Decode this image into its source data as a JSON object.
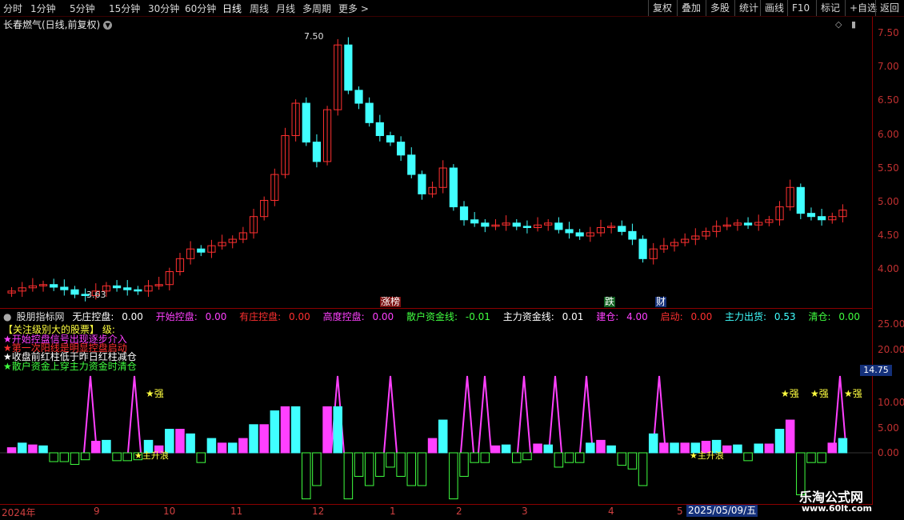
{
  "toolbar": {
    "timeframes": [
      "分时",
      "1分钟",
      "5分钟",
      "15分钟",
      "30分钟",
      "60分钟",
      "日线",
      "周线",
      "月线",
      "多周期",
      "更多 >"
    ],
    "active": "日线",
    "right_buttons": [
      "复权",
      "叠加",
      "多股",
      "统计",
      "画线",
      "F10",
      "标记",
      "+自选",
      "返回"
    ]
  },
  "chart_title": "长春燃气(日线,前复权)",
  "chart_data": [
    {
      "type": "candlestick",
      "title": "长春燃气(日线,前复权)",
      "y_ticks": [
        "7.50",
        "7.00",
        "6.50",
        "6.00",
        "5.50",
        "5.00",
        "4.50",
        "4.00"
      ],
      "ylim": [
        3.5,
        7.7
      ],
      "annotations": {
        "high": "7.50",
        "low": "3.63"
      },
      "event_tags": [
        "涨榜",
        "跌",
        "财"
      ],
      "ohlc_closes": [
        3.7,
        3.75,
        3.78,
        3.8,
        3.76,
        3.72,
        3.65,
        3.63,
        3.7,
        3.78,
        3.75,
        3.72,
        3.7,
        3.78,
        3.8,
        4.0,
        4.2,
        4.35,
        4.3,
        4.4,
        4.45,
        4.5,
        4.6,
        4.85,
        5.1,
        5.5,
        6.1,
        6.6,
        6.0,
        5.7,
        6.5,
        7.5,
        6.8,
        6.6,
        6.3,
        6.1,
        6.0,
        5.8,
        5.5,
        5.2,
        5.3,
        5.6,
        5.0,
        4.8,
        4.75,
        4.7,
        4.72,
        4.75,
        4.7,
        4.68,
        4.72,
        4.75,
        4.65,
        4.6,
        4.55,
        4.6,
        4.68,
        4.7,
        4.62,
        4.5,
        4.2,
        4.35,
        4.4,
        4.45,
        4.5,
        4.55,
        4.62,
        4.7,
        4.72,
        4.75,
        4.72,
        4.76,
        4.8,
        5.0,
        5.3,
        4.9,
        4.85,
        4.8,
        4.85,
        4.95
      ]
    },
    {
      "type": "bar",
      "title": "股朋指标网",
      "y_ticks": [
        "25.00",
        "20.00",
        "15.00",
        "10.00",
        "5.00",
        "0.00"
      ],
      "ylim": [
        -10,
        27
      ],
      "current_value": "14.75"
    }
  ],
  "indicator": {
    "name": "股朋指标网",
    "items": [
      {
        "label": "无庄控盘:",
        "value": "0.00",
        "color": "#ffffff"
      },
      {
        "label": "开始控盘:",
        "value": "0.00",
        "color": "#ff40ff"
      },
      {
        "label": "有庄控盘:",
        "value": "0.00",
        "color": "#ff3030"
      },
      {
        "label": "高度控盘:",
        "value": "0.00",
        "color": "#ff40ff"
      },
      {
        "label": "散户资金线:",
        "value": "-0.01",
        "color": "#40ff40"
      },
      {
        "label": "主力资金线:",
        "value": "0.01",
        "color": "#ffffff"
      },
      {
        "label": "建仓:",
        "value": "4.00",
        "color": "#ff40ff"
      },
      {
        "label": "启动:",
        "value": "0.00",
        "color": "#ff3030"
      },
      {
        "label": "主力出货:",
        "value": "0.53",
        "color": "#40ffff"
      },
      {
        "label": "清仓:",
        "value": "0.00",
        "color": "#40ff40"
      }
    ]
  },
  "legend": [
    {
      "text": "【关注级别大的股票】    级:",
      "color": "#ffff40"
    },
    {
      "text": "★开始控盘信号出现逐步介入",
      "color": "#ff40ff"
    },
    {
      "text": "★第一次阳线是明显控盘启动",
      "color": "#ff3030"
    },
    {
      "text": "★收盘前红柱低于昨日红柱减仓",
      "color": "#ffffff"
    },
    {
      "text": "★散户资金上穿主力资金时清仓",
      "color": "#40ff40"
    }
  ],
  "signals": {
    "strong": "★强",
    "wave1": "★主升浪",
    "wave2": "★主升浪"
  },
  "x_axis": [
    "2024年",
    "9",
    "10",
    "11",
    "12",
    "1",
    "2",
    "3",
    "4",
    "5",
    "5"
  ],
  "date_box": "2025/05/09/五",
  "watermark": {
    "line1": "乐淘公式网",
    "line2": "www.60lt.com"
  },
  "colors": {
    "up": "#ff3030",
    "down": "#40ffff",
    "accent": "#14307a"
  }
}
